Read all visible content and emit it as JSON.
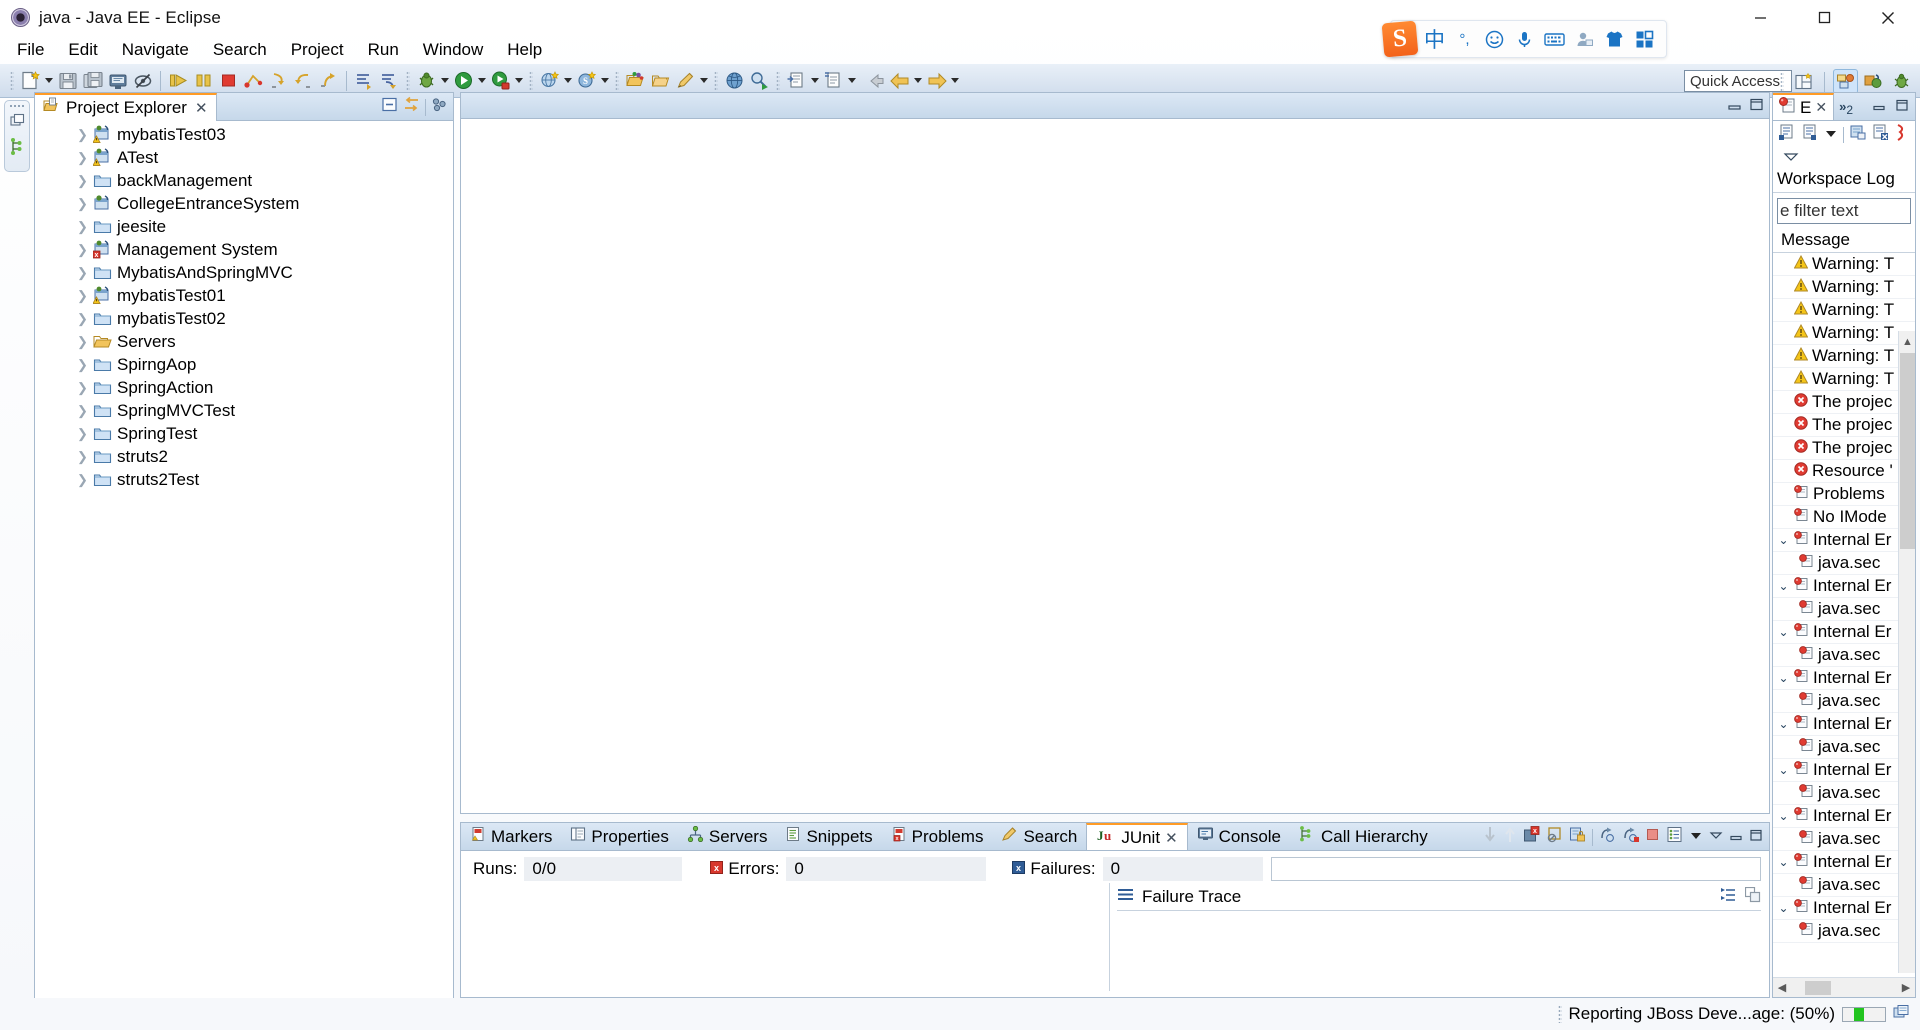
{
  "window": {
    "title": "java - Java EE - Eclipse",
    "app_icon": "eclipse-icon",
    "minimize": "minimize-button",
    "maximize": "maximize-button",
    "close": "close-button"
  },
  "ime": {
    "logo": "sogou-logo",
    "items": [
      {
        "name": "chinese-mode-icon",
        "glyph": "中"
      },
      {
        "name": "punctuation-mode-icon",
        "glyph": "°,"
      },
      {
        "name": "emoji-icon",
        "glyph": "☺"
      },
      {
        "name": "voice-input-icon",
        "glyph": "🎤"
      },
      {
        "name": "soft-keyboard-icon",
        "glyph": "⌨"
      },
      {
        "name": "user-icon",
        "glyph": "👤"
      },
      {
        "name": "skin-icon",
        "glyph": "👕"
      },
      {
        "name": "toolbox-icon",
        "glyph": "▦"
      }
    ]
  },
  "menubar": {
    "items": [
      "File",
      "Edit",
      "Navigate",
      "Search",
      "Project",
      "Run",
      "Window",
      "Help"
    ]
  },
  "toolbar": {
    "quick_access_placeholder": "Quick Access",
    "groups": [
      [
        "new-wizard-icon",
        "new-dropdown",
        "save-icon",
        "save-all-icon",
        "print-icon",
        "toggle-mark-occurrences-icon"
      ],
      [
        "run-icon",
        "suspend-icon",
        "terminate-icon",
        "step-breakpoint-icon",
        "step-into-icon",
        "step-over-icon",
        "step-return-icon"
      ],
      [
        "next-annotation-icon",
        "previous-annotation-icon"
      ],
      [
        "debug-icon",
        "debug-dropdown",
        "run-last-icon",
        "run-dropdown",
        "run-external-icon",
        "external-dropdown"
      ],
      [
        "new-web-project-icon",
        "web-dropdown",
        "new-server-icon",
        "server-dropdown"
      ],
      [
        "open-type-icon",
        "open-task-icon",
        "new-annotation-icon",
        "annotation-dropdown"
      ],
      [
        "open-browser-icon",
        "search-icon"
      ],
      [
        "open-resource-icon",
        "resource-dropdown",
        "new-java-file-icon",
        "java-dropdown"
      ],
      [
        "back-icon",
        "previous-edit-icon",
        "previous-dropdown",
        "forward-icon",
        "forward-dropdown"
      ]
    ],
    "perspectives": [
      {
        "name": "open-perspective-button",
        "active": false
      },
      {
        "name": "java-ee-perspective-button",
        "active": true
      },
      {
        "name": "java-perspective-button",
        "active": false
      },
      {
        "name": "debug-perspective-button",
        "active": false
      }
    ]
  },
  "fastview": {
    "items": [
      "restore-view-icon",
      "project-explorer-fastview-icon"
    ]
  },
  "project_explorer": {
    "tab_label": "Project Explorer",
    "tab_icon": "project-explorer-icon",
    "close_glyph": "✕",
    "tools": [
      "collapse-all-icon",
      "link-with-editor-icon",
      "view-menu-icon"
    ],
    "items": [
      {
        "label": "mybatisTest03",
        "icon": "java-project-warning-icon"
      },
      {
        "label": "ATest",
        "icon": "java-project-warning-icon"
      },
      {
        "label": "backManagement",
        "icon": "folder-icon"
      },
      {
        "label": "CollegeEntranceSystem",
        "icon": "java-project-icon"
      },
      {
        "label": "jeesite",
        "icon": "folder-icon"
      },
      {
        "label": "Management System",
        "icon": "java-project-error-icon"
      },
      {
        "label": "MybatisAndSpringMVC",
        "icon": "folder-icon"
      },
      {
        "label": "mybatisTest01",
        "icon": "java-project-warning-icon"
      },
      {
        "label": "mybatisTest02",
        "icon": "folder-icon"
      },
      {
        "label": "Servers",
        "icon": "open-folder-icon"
      },
      {
        "label": "SpirngAop",
        "icon": "folder-icon"
      },
      {
        "label": "SpringAction",
        "icon": "folder-icon"
      },
      {
        "label": "SpringMVCTest",
        "icon": "folder-icon"
      },
      {
        "label": "SpringTest",
        "icon": "folder-icon"
      },
      {
        "label": "struts2",
        "icon": "folder-icon"
      },
      {
        "label": "struts2Test",
        "icon": "folder-icon"
      }
    ]
  },
  "editor": {
    "tools": [
      "minimize-editor-icon",
      "maximize-editor-icon"
    ]
  },
  "bottom_panel": {
    "tabs": [
      {
        "label": "Markers",
        "icon": "markers-icon",
        "active": false
      },
      {
        "label": "Properties",
        "icon": "properties-icon",
        "active": false
      },
      {
        "label": "Servers",
        "icon": "servers-icon",
        "active": false
      },
      {
        "label": "Snippets",
        "icon": "snippets-icon",
        "active": false
      },
      {
        "label": "Problems",
        "icon": "problems-icon",
        "active": false
      },
      {
        "label": "Search",
        "icon": "search-view-icon",
        "active": false
      },
      {
        "label": "JUnit",
        "icon": "junit-icon",
        "active": true
      },
      {
        "label": "Console",
        "icon": "console-icon",
        "active": false
      },
      {
        "label": "Call Hierarchy",
        "icon": "call-hierarchy-icon",
        "active": false
      }
    ],
    "active_close_glyph": "✕",
    "tools": [
      "next-failure-icon",
      "previous-failure-icon",
      "show-failures-only-icon",
      "stop-junit-icon",
      "lock-scroll-icon",
      "rerun-test-icon",
      "rerun-failed-icon",
      "terminate-icon",
      "test-history-icon",
      "view-menu-icon",
      "minimize-icon",
      "maximize-icon"
    ],
    "junit": {
      "runs_label": "Runs:",
      "runs_value": "0/0",
      "errors_label": "Errors:",
      "errors_value": "0",
      "errors_icon": "error-box-icon",
      "failures_label": "Failures:",
      "failures_value": "0",
      "failures_icon": "failure-box-icon",
      "failure_trace_label": "Failure Trace",
      "failure_trace_icon": "failure-trace-icon",
      "trace_tools": [
        "compare-result-icon",
        "copy-trace-icon"
      ]
    }
  },
  "right_panel": {
    "tab_label": "E",
    "tab_icon": "error-log-icon",
    "close_glyph": "✕",
    "overflow_glyph": "»",
    "overflow_count": "2",
    "window_buttons": [
      "minimize-icon",
      "maximize-icon"
    ],
    "tools": [
      "export-log-icon",
      "import-log-icon",
      "filters-dropdown",
      "open-log-icon",
      "delete-log-icon",
      "restore-log-icon",
      "view-menu-icon"
    ],
    "title": "Workspace Log",
    "filter_text": "e filter text",
    "column_header": "Message",
    "entries": [
      {
        "text": "Warning: T",
        "icon": "warning-icon",
        "level": 0,
        "expandable": false
      },
      {
        "text": "Warning: T",
        "icon": "warning-icon",
        "level": 0,
        "expandable": false
      },
      {
        "text": "Warning: T",
        "icon": "warning-icon",
        "level": 0,
        "expandable": false
      },
      {
        "text": "Warning: T",
        "icon": "warning-icon",
        "level": 0,
        "expandable": false
      },
      {
        "text": "Warning: T",
        "icon": "warning-icon",
        "level": 0,
        "expandable": false
      },
      {
        "text": "Warning: T",
        "icon": "warning-icon",
        "level": 0,
        "expandable": false
      },
      {
        "text": "The projec",
        "icon": "error-icon",
        "level": 0,
        "expandable": false
      },
      {
        "text": "The projec",
        "icon": "error-icon",
        "level": 0,
        "expandable": false
      },
      {
        "text": "The projec",
        "icon": "error-icon",
        "level": 0,
        "expandable": false
      },
      {
        "text": "Resource '",
        "icon": "error-icon",
        "level": 0,
        "expandable": false
      },
      {
        "text": "Problems ",
        "icon": "error-log-entry-icon",
        "level": 0,
        "expandable": false
      },
      {
        "text": "No IMode",
        "icon": "error-log-entry-icon",
        "level": 0,
        "expandable": false
      },
      {
        "text": "Internal Er",
        "icon": "error-log-entry-icon",
        "level": 0,
        "expandable": true
      },
      {
        "text": "java.sec",
        "icon": "error-log-entry-icon",
        "level": 1,
        "expandable": false
      },
      {
        "text": "Internal Er",
        "icon": "error-log-entry-icon",
        "level": 0,
        "expandable": true
      },
      {
        "text": "java.sec",
        "icon": "error-log-entry-icon",
        "level": 1,
        "expandable": false
      },
      {
        "text": "Internal Er",
        "icon": "error-log-entry-icon",
        "level": 0,
        "expandable": true
      },
      {
        "text": "java.sec",
        "icon": "error-log-entry-icon",
        "level": 1,
        "expandable": false
      },
      {
        "text": "Internal Er",
        "icon": "error-log-entry-icon",
        "level": 0,
        "expandable": true
      },
      {
        "text": "java.sec",
        "icon": "error-log-entry-icon",
        "level": 1,
        "expandable": false
      },
      {
        "text": "Internal Er",
        "icon": "error-log-entry-icon",
        "level": 0,
        "expandable": true
      },
      {
        "text": "java.sec",
        "icon": "error-log-entry-icon",
        "level": 1,
        "expandable": false
      },
      {
        "text": "Internal Er",
        "icon": "error-log-entry-icon",
        "level": 0,
        "expandable": true
      },
      {
        "text": "java.sec",
        "icon": "error-log-entry-icon",
        "level": 1,
        "expandable": false
      },
      {
        "text": "Internal Er",
        "icon": "error-log-entry-icon",
        "level": 0,
        "expandable": true
      },
      {
        "text": "java.sec",
        "icon": "error-log-entry-icon",
        "level": 1,
        "expandable": false
      },
      {
        "text": "Internal Er",
        "icon": "error-log-entry-icon",
        "level": 0,
        "expandable": true
      },
      {
        "text": "java.sec",
        "icon": "error-log-entry-icon",
        "level": 1,
        "expandable": false
      },
      {
        "text": "Internal Er",
        "icon": "error-log-entry-icon",
        "level": 0,
        "expandable": true
      },
      {
        "text": "java.sec",
        "icon": "error-log-entry-icon",
        "level": 1,
        "expandable": false
      }
    ]
  },
  "statusbar": {
    "text": "Reporting JBoss Deve...age: (50%)",
    "progress_percent": 50,
    "progress_color": "#22c41e",
    "progress_icon": "background-jobs-icon"
  }
}
